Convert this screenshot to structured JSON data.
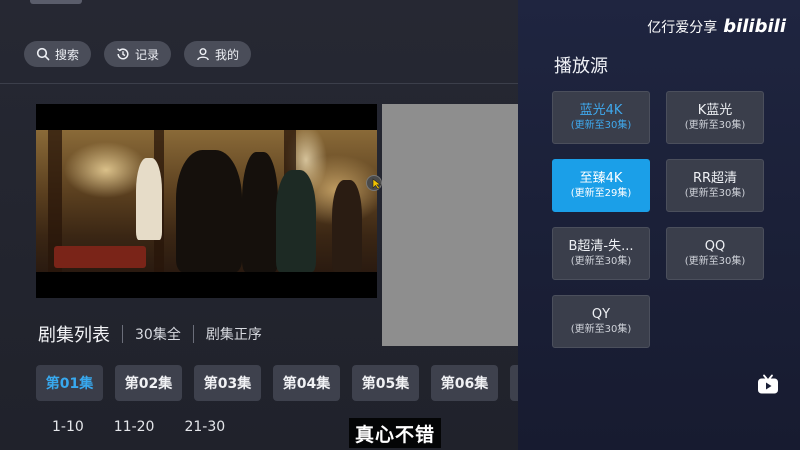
{
  "nav": {
    "search_label": "搜索",
    "history_label": "记录",
    "mine_label": "我的",
    "icons": [
      "search-icon",
      "history-icon",
      "user-icon"
    ]
  },
  "player": {
    "subtitle": "真心不错"
  },
  "episodes": {
    "title": "剧集列表",
    "total": "30集全",
    "order": "剧集正序",
    "items": [
      "第01集",
      "第02集",
      "第03集",
      "第04集",
      "第05集",
      "第06集"
    ],
    "active_index": 0,
    "ranges": [
      "1-10",
      "11-20",
      "21-30"
    ]
  },
  "source_panel": {
    "watermark_text": "亿行爱分享",
    "watermark_logo": "bilibili",
    "title": "播放源",
    "sources": [
      {
        "name": "蓝光4K",
        "sub": "(更新至30集)",
        "state": "current"
      },
      {
        "name": "K蓝光",
        "sub": "(更新至30集)",
        "state": "normal"
      },
      {
        "name": "至臻4K",
        "sub": "(更新至29集)",
        "state": "selected"
      },
      {
        "name": "RR超清",
        "sub": "(更新至30集)",
        "state": "normal"
      },
      {
        "name": "B超清-失...",
        "sub": "(更新至30集)",
        "state": "normal"
      },
      {
        "name": "QQ",
        "sub": "(更新至30集)",
        "state": "normal"
      },
      {
        "name": "QY",
        "sub": "(更新至30集)",
        "state": "normal"
      }
    ]
  },
  "colors": {
    "accent": "#1b9fe8",
    "active_text": "#38a9ef",
    "panel_bg": "#1f2540"
  }
}
